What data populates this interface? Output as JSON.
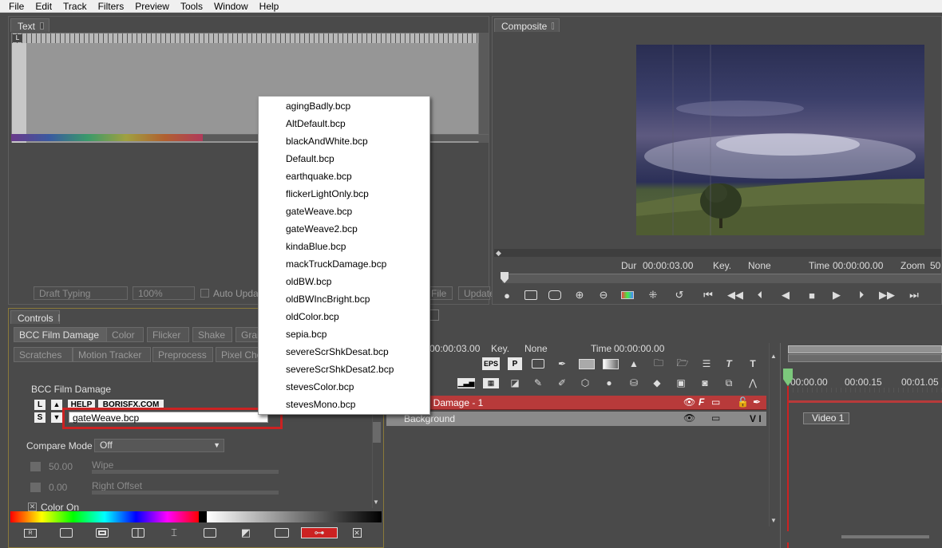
{
  "menu": [
    "File",
    "Edit",
    "Track",
    "Filters",
    "Preview",
    "Tools",
    "Window",
    "Help"
  ],
  "text_panel": {
    "tab": "Text",
    "draft_typing": "Draft Typing",
    "zoom": "100%",
    "auto_update": "Auto Update",
    "file_btn": "File",
    "update_btn": "Update"
  },
  "composite": {
    "tab": "Composite",
    "dur_label": "Dur",
    "dur_value": "00:00:03.00",
    "key_label": "Key.",
    "key_value": "None",
    "time_label": "Time",
    "time_value": "00:00:00.00",
    "zoom_label": "Zoom",
    "zoom_value": "50"
  },
  "controls": {
    "tab": "Controls",
    "subtabs_row1": [
      "BCC Film Damage",
      "Color",
      "Flicker",
      "Shake",
      "Grain"
    ],
    "subtabs_row2": [
      "Scratches",
      "Motion Tracker",
      "Preprocess",
      "Pixel Chooser"
    ],
    "filter_title": "BCC Film Damage",
    "help_label": "HELP",
    "borisfx_label": "BORISFX.COM",
    "preset_value": "gateWeave.bcp",
    "compare_mode_label": "Compare Mode",
    "compare_mode_value": "Off",
    "wipe_value": "50.00",
    "wipe_label": "Wipe",
    "right_offset_value": "0.00",
    "right_offset_label": "Right Offset",
    "color_on_label": "Color On"
  },
  "timeline": {
    "dur_value": "00:00:03.00",
    "key_label": "Key.",
    "key_value": "None",
    "time_label": "Time",
    "time_value": "00:00:00.00",
    "ruler_labels": [
      "00:00.00",
      "00:00.15",
      "00:01.05"
    ],
    "track1_name": "BCC Film Damage - 1",
    "track2_name": "Background",
    "track2_flags": "V I",
    "clip_label": "Video 1",
    "eps_label": "EPS",
    "p_label": "P"
  },
  "presets": [
    "agingBadly.bcp",
    "AltDefault.bcp",
    "blackAndWhite.bcp",
    "Default.bcp",
    "earthquake.bcp",
    "flickerLightOnly.bcp",
    "gateWeave.bcp",
    "gateWeave2.bcp",
    "kindaBlue.bcp",
    "mackTruckDamage.bcp",
    "oldBW.bcp",
    "oldBWIncBright.bcp",
    "oldColor.bcp",
    "sepia.bcp",
    "severeScrShkDesat.bcp",
    "severeScrShkDesat2.bcp",
    "stevesColor.bcp",
    "stevesMono.bcp"
  ],
  "colors": {
    "highlight_red": "#cc2222",
    "track_red": "#b83a3a",
    "panel_bg": "#4a4a4a"
  }
}
